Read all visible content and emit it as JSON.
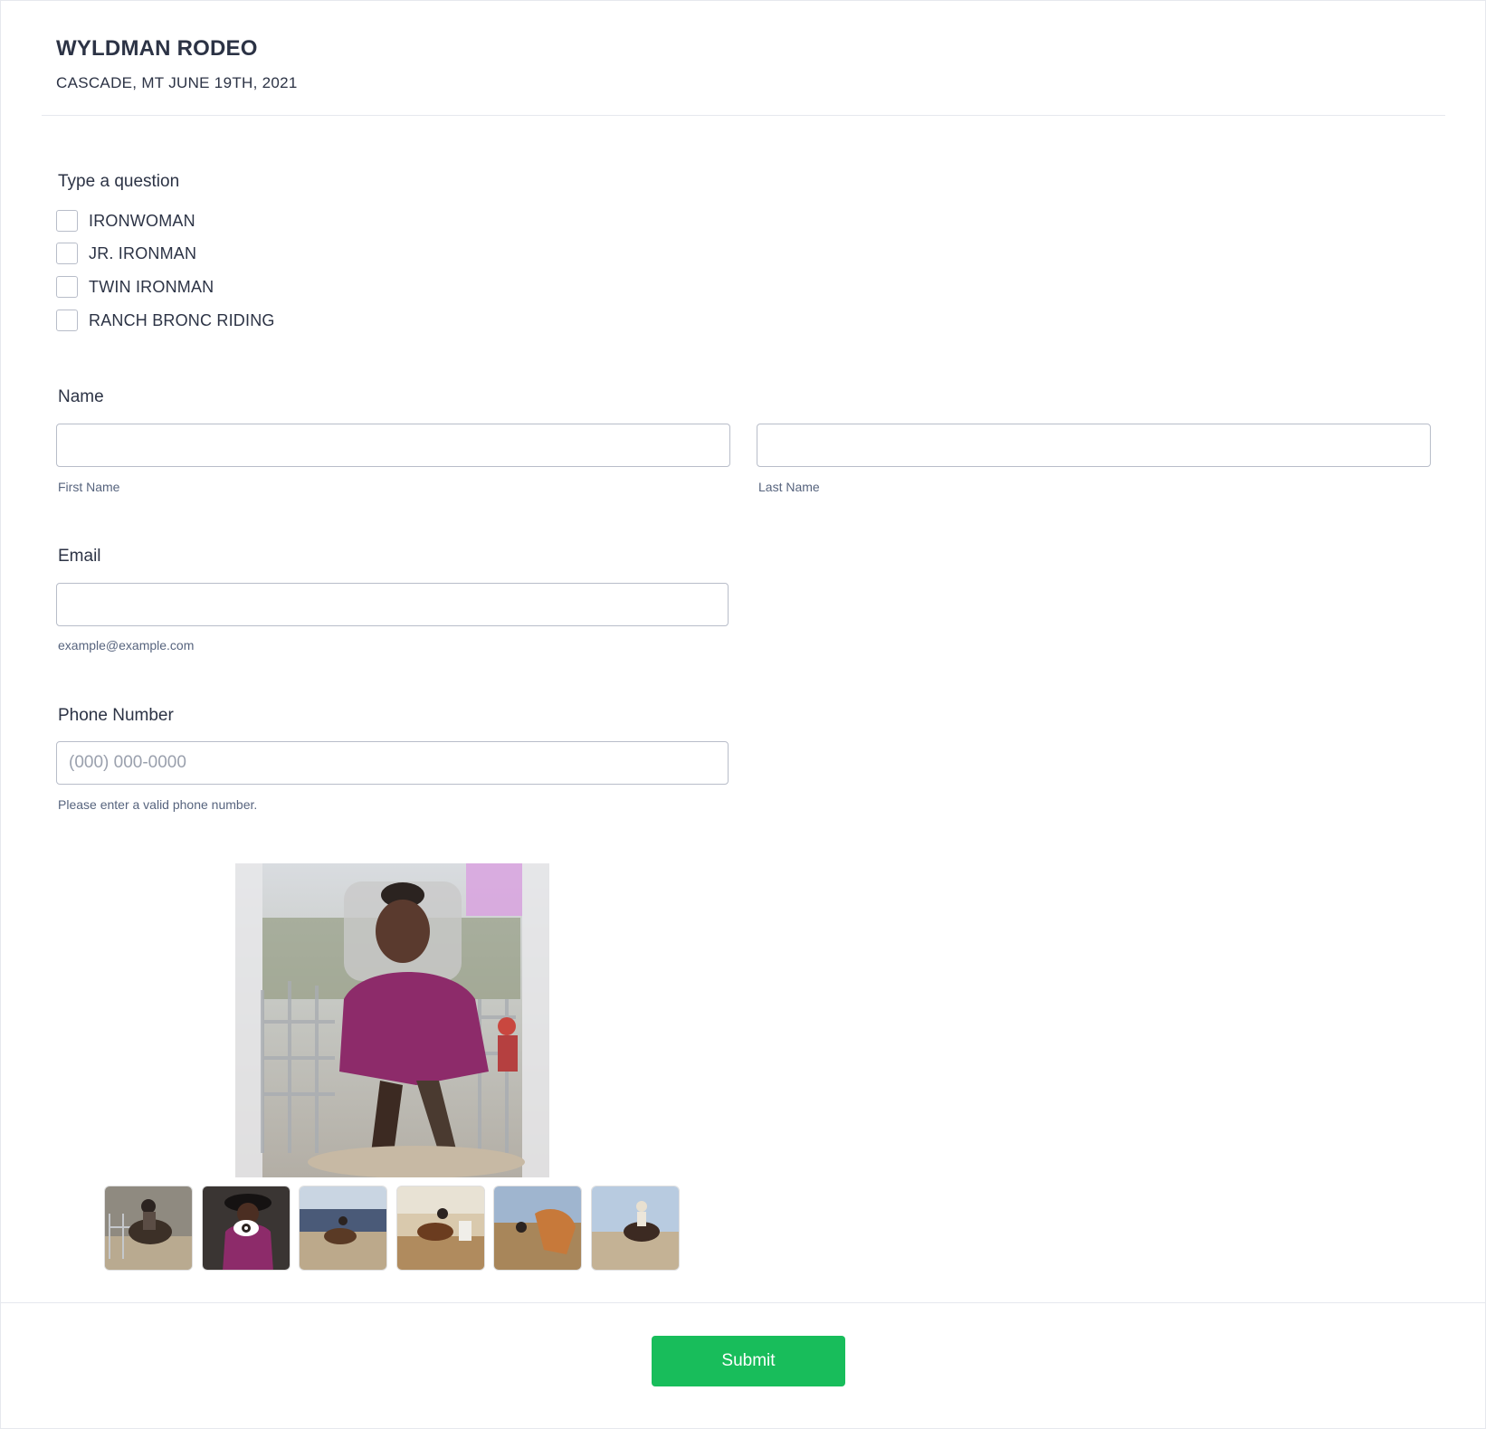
{
  "header": {
    "title": "WYLDMAN RODEO",
    "subtitle": "CASCADE, MT JUNE 19TH, 2021"
  },
  "checkbox_question": {
    "label": "Type a question",
    "options": [
      {
        "label": "IRONWOMAN",
        "checked": false
      },
      {
        "label": "JR. IRONMAN",
        "checked": false
      },
      {
        "label": "TWIN IRONMAN",
        "checked": false
      },
      {
        "label": "RANCH BRONC RIDING",
        "checked": false
      }
    ]
  },
  "name_field": {
    "label": "Name",
    "first": {
      "value": "",
      "sublabel": "First Name"
    },
    "last": {
      "value": "",
      "sublabel": "Last Name"
    }
  },
  "email_field": {
    "label": "Email",
    "value": "",
    "sublabel": "example@example.com"
  },
  "phone_field": {
    "label": "Phone Number",
    "value": "",
    "placeholder": "(000) 000-0000",
    "sublabel": "Please enter a valid phone number."
  },
  "gallery": {
    "main_image": "rodeo-rider-bronc-main",
    "thumbnails": [
      {
        "name": "rodeo-bronc-thumb-1"
      },
      {
        "name": "rodeo-rider-thumb-2",
        "icon": "eye-icon"
      },
      {
        "name": "rodeo-barrel-thumb-3"
      },
      {
        "name": "rodeo-barrel-thumb-4"
      },
      {
        "name": "rodeo-roping-thumb-5"
      },
      {
        "name": "rodeo-bronc-thumb-6"
      }
    ]
  },
  "footer": {
    "submit_label": "Submit"
  },
  "colors": {
    "accent": "#18bd5b",
    "text": "#2c3345",
    "border": "#b8bdc9"
  }
}
